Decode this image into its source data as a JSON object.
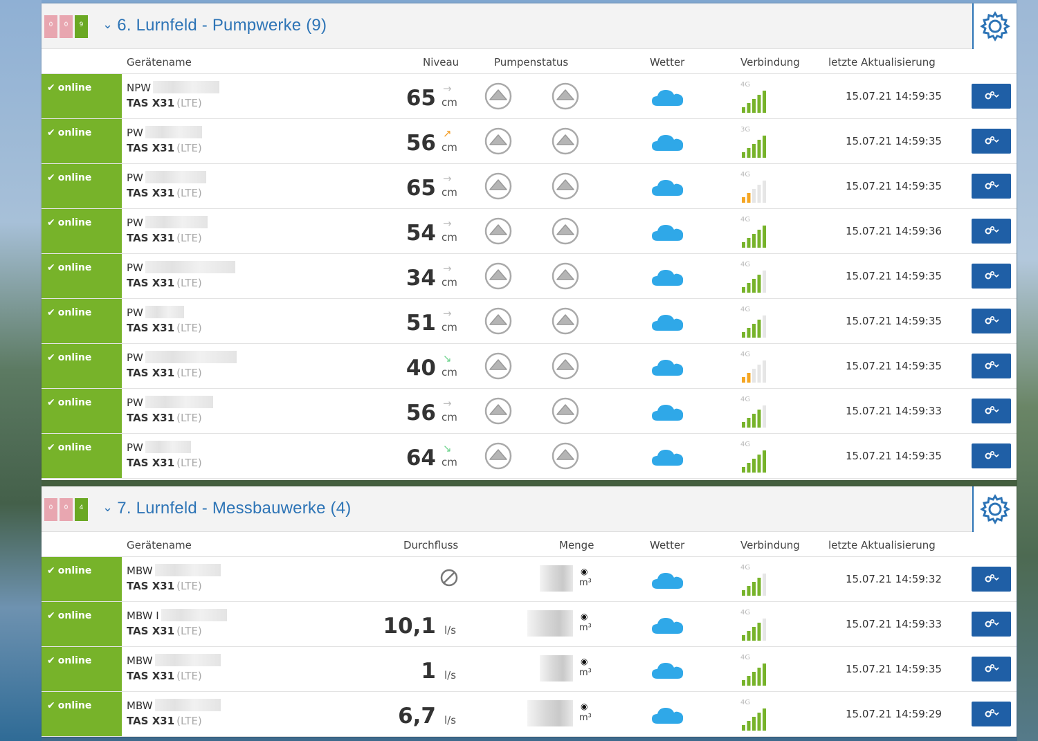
{
  "colors": {
    "accent": "#2d74b6",
    "online": "#77b32a",
    "button": "#1f5fa6",
    "signal_good": "#77b32a",
    "signal_weak": "#f5a623"
  },
  "groups": [
    {
      "title": "6. Lurnfeld - Pumpwerke (9)",
      "counters": [
        "0",
        "0",
        "9"
      ],
      "columns": {
        "name": "Gerätename",
        "level": "Niveau",
        "pump": "Pumpenstatus",
        "weather": "Wetter",
        "connection": "Verbindung",
        "updated": "letzte Aktualisierung"
      },
      "rows": [
        {
          "status": "online",
          "name": "NPW",
          "type": "TAS X31",
          "type_sub": "(LTE)",
          "value": "65",
          "unit": "cm",
          "arrow": "→",
          "trend": "flat",
          "net": "4G",
          "bars": 5,
          "time": "15.07.21 14:59:35"
        },
        {
          "status": "online",
          "name": "PW",
          "type": "TAS X31",
          "type_sub": "(LTE)",
          "value": "56",
          "unit": "cm",
          "arrow": "↗",
          "trend": "up",
          "net": "3G",
          "bars": 5,
          "time": "15.07.21 14:59:35"
        },
        {
          "status": "online",
          "name": "PW",
          "type": "TAS X31",
          "type_sub": "(LTE)",
          "value": "65",
          "unit": "cm",
          "arrow": "→",
          "trend": "flat",
          "net": "4G",
          "bars": 2,
          "time": "15.07.21 14:59:35"
        },
        {
          "status": "online",
          "name": "PW",
          "type": "TAS X31",
          "type_sub": "(LTE)",
          "value": "54",
          "unit": "cm",
          "arrow": "→",
          "trend": "flat",
          "net": "4G",
          "bars": 5,
          "time": "15.07.21 14:59:36"
        },
        {
          "status": "online",
          "name": "PW",
          "type": "TAS X31",
          "type_sub": "(LTE)",
          "value": "34",
          "unit": "cm",
          "arrow": "→",
          "trend": "flat",
          "net": "4G",
          "bars": 4,
          "time": "15.07.21 14:59:35"
        },
        {
          "status": "online",
          "name": "PW",
          "type": "TAS X31",
          "type_sub": "(LTE)",
          "value": "51",
          "unit": "cm",
          "arrow": "→",
          "trend": "flat",
          "net": "4G",
          "bars": 4,
          "time": "15.07.21 14:59:35"
        },
        {
          "status": "online",
          "name": "PW",
          "type": "TAS X31",
          "type_sub": "(LTE)",
          "value": "40",
          "unit": "cm",
          "arrow": "↘",
          "trend": "down",
          "net": "4G",
          "bars": 2,
          "time": "15.07.21 14:59:35"
        },
        {
          "status": "online",
          "name": "PW",
          "type": "TAS X31",
          "type_sub": "(LTE)",
          "value": "56",
          "unit": "cm",
          "arrow": "→",
          "trend": "flat",
          "net": "4G",
          "bars": 4,
          "time": "15.07.21 14:59:33"
        },
        {
          "status": "online",
          "name": "PW",
          "type": "TAS X31",
          "type_sub": "(LTE)",
          "value": "64",
          "unit": "cm",
          "arrow": "↘",
          "trend": "down",
          "net": "4G",
          "bars": 5,
          "time": "15.07.21 14:59:35"
        }
      ]
    },
    {
      "title": "7. Lurnfeld - Messbauwerke (4)",
      "counters": [
        "0",
        "0",
        "4"
      ],
      "columns": {
        "name": "Gerätename",
        "flow": "Durchfluss",
        "amount": "Menge",
        "weather": "Wetter",
        "connection": "Verbindung",
        "updated": "letzte Aktualisierung"
      },
      "rows": [
        {
          "status": "online",
          "name": "MBW",
          "type": "TAS X31",
          "type_sub": "(LTE)",
          "value": "",
          "unit": "",
          "nodata": true,
          "amount_unit": "m³",
          "net": "4G",
          "bars": 4,
          "time": "15.07.21 14:59:32"
        },
        {
          "status": "online",
          "name": "MBW I",
          "type": "TAS X31",
          "type_sub": "(LTE)",
          "value": "10,1",
          "unit": "l/s",
          "amount_unit": "m³",
          "net": "4G",
          "bars": 4,
          "time": "15.07.21 14:59:33"
        },
        {
          "status": "online",
          "name": "MBW",
          "type": "TAS X31",
          "type_sub": "(LTE)",
          "value": "1",
          "unit": "l/s",
          "amount_unit": "m³",
          "net": "4G",
          "bars": 5,
          "time": "15.07.21 14:59:35"
        },
        {
          "status": "online",
          "name": "MBW",
          "type": "TAS X31",
          "type_sub": "(LTE)",
          "value": "6,7",
          "unit": "l/s",
          "amount_unit": "m³",
          "net": "4G",
          "bars": 5,
          "time": "15.07.21 14:59:29"
        }
      ]
    }
  ],
  "icons": {
    "gear": "gear-icon",
    "chevron": "chevron-down-icon",
    "check": "check-icon",
    "cloud": "cloud-icon",
    "pump": "pump-status-icon",
    "signal": "signal-icon",
    "camera": "camera-icon",
    "nodata": "no-data-icon"
  }
}
